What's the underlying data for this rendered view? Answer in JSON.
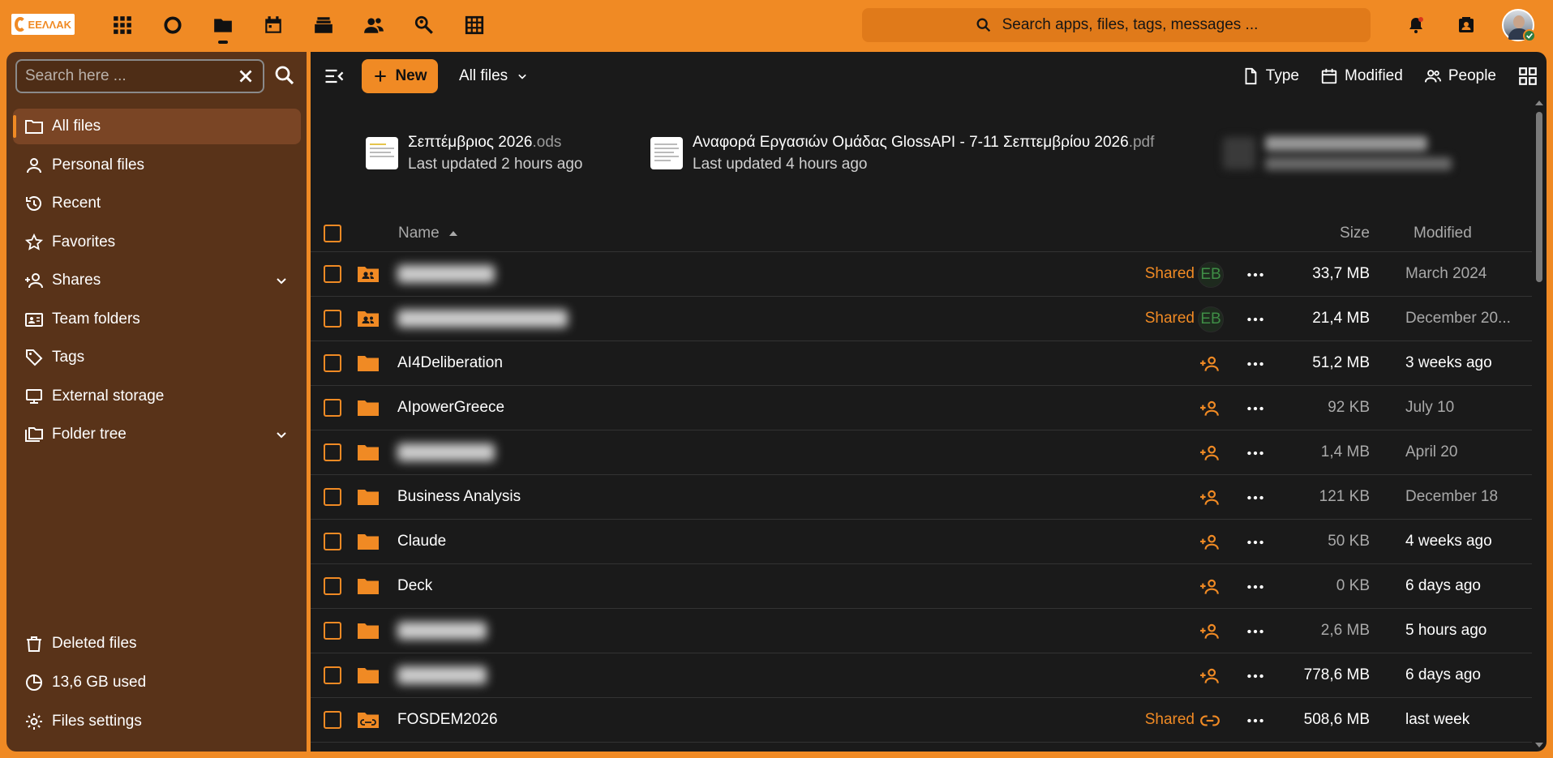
{
  "brand": {
    "logo_text": "ΕΕΛΛΑΚ",
    "accent": "#f08a24"
  },
  "apps": [
    "dashboard-icon",
    "circles-icon",
    "files-icon",
    "calendar-icon",
    "deck-icon",
    "contacts-icon",
    "search-people-icon",
    "tables-icon"
  ],
  "unified_search": {
    "placeholder": "Search apps, files, tags, messages ..."
  },
  "sidebar": {
    "search_placeholder": "Search here ...",
    "items": [
      {
        "label": "All files",
        "icon": "folder-icon",
        "active": true
      },
      {
        "label": "Personal files",
        "icon": "person-icon"
      },
      {
        "label": "Recent",
        "icon": "history-icon"
      },
      {
        "label": "Favorites",
        "icon": "star-icon"
      },
      {
        "label": "Shares",
        "icon": "share-person-icon",
        "expandable": true
      },
      {
        "label": "Team folders",
        "icon": "team-folder-icon"
      },
      {
        "label": "Tags",
        "icon": "tag-icon"
      },
      {
        "label": "External storage",
        "icon": "external-storage-icon"
      },
      {
        "label": "Folder tree",
        "icon": "folder-tree-icon",
        "expandable": true
      }
    ],
    "bottom": [
      {
        "label": "Deleted files",
        "icon": "trash-icon"
      },
      {
        "label": "13,6 GB used",
        "icon": "pie-chart-icon"
      },
      {
        "label": "Files settings",
        "icon": "gear-icon"
      }
    ]
  },
  "toolbar": {
    "new_label": "New",
    "breadcrumb": "All files",
    "filters": {
      "type": "Type",
      "modified": "Modified",
      "people": "People"
    }
  },
  "recent_files": [
    {
      "name": "Σεπτέμβριος 2026",
      "ext": ".ods",
      "updated": "Last updated 2 hours ago"
    },
    {
      "name": "Αναφορά Εργασιών Ομάδας GlossAPI - 7-11 Σεπτεμβρίου 2026",
      "ext": ".pdf",
      "updated": "Last updated 4 hours ago"
    }
  ],
  "table": {
    "headers": {
      "name": "Name",
      "size": "Size",
      "modified": "Modified"
    },
    "rows": [
      {
        "name": "",
        "blurred": true,
        "kind": "shared-folder",
        "shared": "Shared",
        "share": "EB",
        "size": "33,7 MB",
        "modified": "March 2024",
        "size_dim": false,
        "mod_dim": true
      },
      {
        "name": "",
        "blurred": true,
        "kind": "shared-folder",
        "shared": "Shared",
        "share": "EB",
        "size": "21,4 MB",
        "modified": "December 20...",
        "size_dim": false,
        "mod_dim": true
      },
      {
        "name": "AI4Deliberation",
        "kind": "folder",
        "shared": "",
        "share": "add",
        "size": "51,2 MB",
        "modified": "3 weeks ago",
        "size_dim": false,
        "mod_dim": false
      },
      {
        "name": "AIpowerGreece",
        "kind": "folder",
        "shared": "",
        "share": "add",
        "size": "92 KB",
        "modified": "July 10",
        "size_dim": true,
        "mod_dim": true
      },
      {
        "name": "",
        "blurred": true,
        "kind": "folder",
        "shared": "",
        "share": "add",
        "size": "1,4 MB",
        "modified": "April 20",
        "size_dim": true,
        "mod_dim": true
      },
      {
        "name": "Business Analysis",
        "kind": "folder",
        "shared": "",
        "share": "add",
        "size": "121 KB",
        "modified": "December 18",
        "size_dim": true,
        "mod_dim": true
      },
      {
        "name": "Claude",
        "kind": "folder",
        "shared": "",
        "share": "add",
        "size": "50 KB",
        "modified": "4 weeks ago",
        "size_dim": true,
        "mod_dim": false
      },
      {
        "name": "Deck",
        "kind": "folder",
        "shared": "",
        "share": "add",
        "size": "0 KB",
        "modified": "6 days ago",
        "size_dim": true,
        "mod_dim": false
      },
      {
        "name": "",
        "blurred": true,
        "kind": "folder",
        "shared": "",
        "share": "add",
        "size": "2,6 MB",
        "modified": "5 hours ago",
        "size_dim": true,
        "mod_dim": false
      },
      {
        "name": "",
        "blurred": true,
        "kind": "folder",
        "shared": "",
        "share": "add",
        "size": "778,6 MB",
        "modified": "6 days ago",
        "size_dim": false,
        "mod_dim": false
      },
      {
        "name": "FOSDEM2026",
        "kind": "link-folder",
        "shared": "Shared",
        "share": "link",
        "size": "508,6 MB",
        "modified": "last week",
        "size_dim": false,
        "mod_dim": false
      }
    ]
  }
}
